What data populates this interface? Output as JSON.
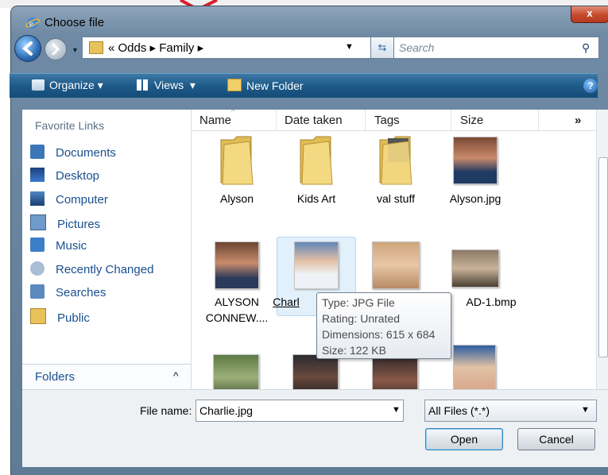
{
  "window": {
    "title": "Choose file",
    "close_glyph": "x"
  },
  "navigation": {
    "address_prefix": "«",
    "breadcrumb": [
      "Odds",
      "Family"
    ],
    "separator": "▸",
    "search_placeholder": "Search"
  },
  "toolbar": {
    "organize": "Organize",
    "views": "Views",
    "new_folder": "New Folder",
    "help": "?"
  },
  "favorites": {
    "heading": "Favorite Links",
    "items": [
      {
        "label": "Documents",
        "icon": "documents-icon"
      },
      {
        "label": "Desktop",
        "icon": "desktop-icon"
      },
      {
        "label": "Computer",
        "icon": "computer-icon"
      },
      {
        "label": "Pictures",
        "icon": "pictures-icon"
      },
      {
        "label": "Music",
        "icon": "music-icon"
      },
      {
        "label": "Recently Changed",
        "icon": "recently-changed-icon"
      },
      {
        "label": "Searches",
        "icon": "searches-icon"
      },
      {
        "label": "Public",
        "icon": "public-folder-icon"
      }
    ],
    "folders_label": "Folders",
    "folders_chevron": "^"
  },
  "columns": [
    "Name",
    "Date taken",
    "Tags",
    "Size"
  ],
  "columns_more": "»",
  "files": [
    {
      "name": "Alyson",
      "type": "folder"
    },
    {
      "name": "Kids Art",
      "type": "folder"
    },
    {
      "name": "val stuff",
      "type": "folder"
    },
    {
      "name": "Alyson.jpg",
      "type": "image"
    },
    {
      "name": "ALYSON",
      "name2": "CONNEW....",
      "type": "image"
    },
    {
      "name": "Charl",
      "type": "image",
      "selected": true
    },
    {
      "name": "",
      "type": "image"
    },
    {
      "name": "AD-1.bmp",
      "type": "image"
    }
  ],
  "tooltip": {
    "type": "Type: JPG File",
    "rating": "Rating: Unrated",
    "dimensions": "Dimensions: 615 x 684",
    "size": "Size: 122 KB"
  },
  "footer": {
    "file_name_label": "File name:",
    "file_name_value": "Charlie.jpg",
    "filter_value": "All Files (*.*)",
    "open_label": "Open",
    "cancel_label": "Cancel"
  }
}
